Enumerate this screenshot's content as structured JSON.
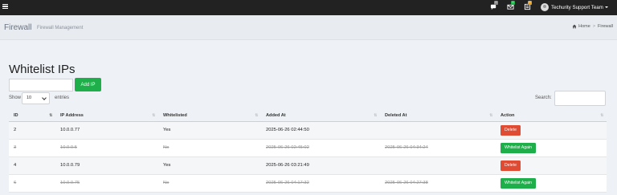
{
  "topbar": {
    "icons": [
      {
        "name": "messages-icon",
        "badge": "0",
        "badge_color": "#888888"
      },
      {
        "name": "mail-icon",
        "badge": "0",
        "badge_color": "#1eae4a"
      },
      {
        "name": "tasks-icon",
        "badge": "0",
        "badge_color": "#e8a020"
      }
    ],
    "user_name": "Techurity Support Team"
  },
  "header": {
    "title": "Firewall",
    "subtitle": "Firewall Management",
    "breadcrumb": [
      "Home",
      "Firewall"
    ]
  },
  "main": {
    "heading": "Whitelist IPs",
    "add_button": "Add IP",
    "show_label": "Show",
    "entries_select": "10",
    "entries_label": "entries",
    "search_label": "Search:"
  },
  "table": {
    "columns": [
      "ID",
      "IP Address",
      "Whitelisted",
      "Added At",
      "Deleted At",
      "Action"
    ],
    "rows": [
      {
        "id": "2",
        "ip": "10.0.0.77",
        "whitelisted": "Yes",
        "added": "2025-06-26 02:44:50",
        "deleted": "",
        "action": "Delete",
        "is_deleted": false
      },
      {
        "id": "3",
        "ip": "10.0.0.5",
        "whitelisted": "No",
        "added": "2025-06-26 02:45:02",
        "deleted": "2025-06-26 04:34:24",
        "action": "Whitelist Again",
        "is_deleted": true
      },
      {
        "id": "4",
        "ip": "10.0.0.79",
        "whitelisted": "Yes",
        "added": "2025-06-26 03:21:49",
        "deleted": "",
        "action": "Delete",
        "is_deleted": false
      },
      {
        "id": "6",
        "ip": "10.0.0.75",
        "whitelisted": "No",
        "added": "2025-06-26 04:17:32",
        "deleted": "2025-06-26 04:27:38",
        "action": "Whitelist Again",
        "is_deleted": true
      }
    ]
  },
  "colors": {
    "topbar": "#222222",
    "success": "#1eae4a",
    "danger": "#df4b33"
  }
}
